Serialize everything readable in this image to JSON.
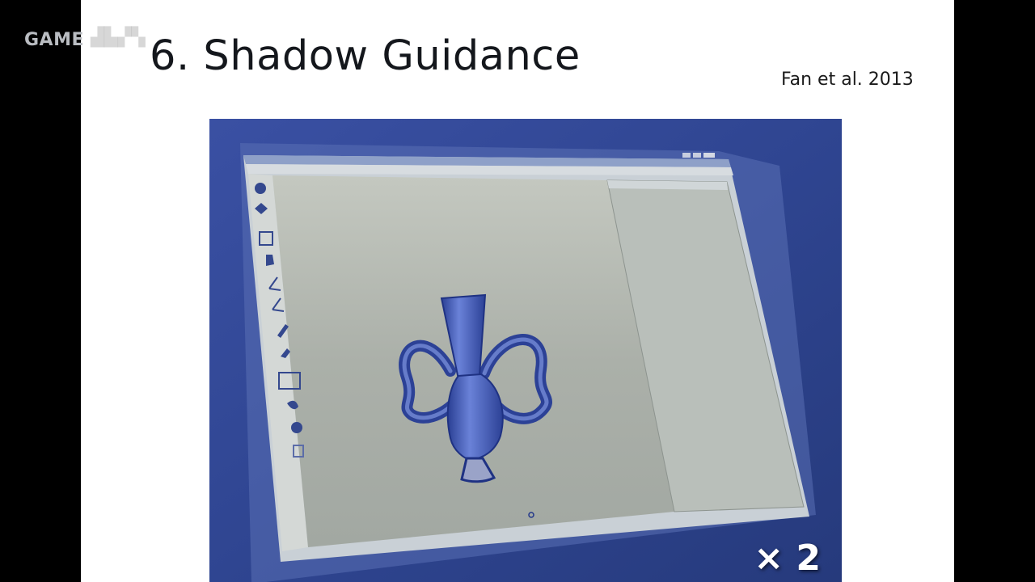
{
  "watermark": {
    "text": "GAME"
  },
  "slide": {
    "title": "6. Shadow Guidance",
    "citation": "Fan et al. 2013",
    "photo": {
      "speed_label": "× 2"
    }
  },
  "colors": {
    "monitor_bezel": "#34499a",
    "screen_bg": "#a8ada7",
    "vase_blue": "#3e56b4",
    "slide_bg": "#ffffff",
    "title_text": "#14171c"
  },
  "icons": [
    "sphere-icon",
    "gem-icon",
    "cursor-icon",
    "hand-icon",
    "line-icon",
    "angle-icon",
    "pencil-icon",
    "brush-icon",
    "select-icon",
    "leaf-icon",
    "gear-icon",
    "copy-icon"
  ]
}
